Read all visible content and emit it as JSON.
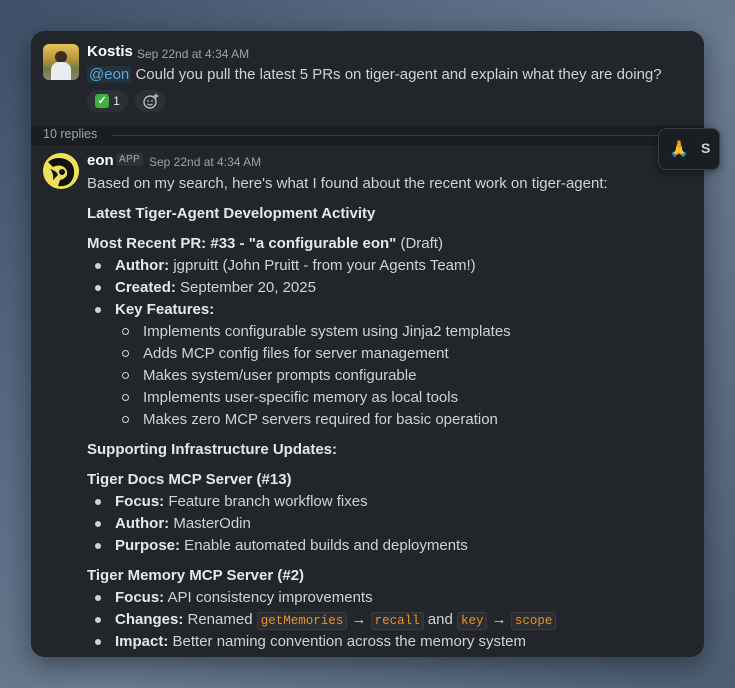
{
  "message1": {
    "author": "Kostis",
    "timestamp": "Sep 22nd at 4:34 AM",
    "mention": "@eon",
    "text": "Could you pull the latest 5 PRs on tiger-agent and explain what they are doing?",
    "reaction": {
      "emoji": "white-check-mark",
      "count": "1"
    }
  },
  "thread": {
    "replies_label": "10 replies"
  },
  "message2": {
    "author": "eon",
    "badge": "APP",
    "timestamp": "Sep 22nd at 4:34 AM",
    "intro": "Based on my search, here's what I found about the recent work on tiger-agent:",
    "heading1": "Latest Tiger-Agent Development Activity",
    "pr33": {
      "title_bold": "Most Recent PR: #33 - \"a configurable eon\"",
      "title_suffix": " (Draft)",
      "author_label": "Author:",
      "author_value": " jgpruitt (John Pruitt - from your Agents Team!)",
      "created_label": "Created:",
      "created_value": " September 20, 2025",
      "features_label": "Key Features:",
      "features": [
        "Implements configurable system using Jinja2 templates",
        "Adds MCP config files for server management",
        "Makes system/user prompts configurable",
        "Implements user-specific memory as local tools",
        "Makes zero MCP servers required for basic operation"
      ]
    },
    "heading2": "Supporting Infrastructure Updates:",
    "docs": {
      "title": "Tiger Docs MCP Server (#13)",
      "focus_label": "Focus:",
      "focus_value": " Feature branch workflow fixes",
      "author_label": "Author:",
      "author_value": " MasterOdin",
      "purpose_label": "Purpose:",
      "purpose_value": " Enable automated builds and deployments"
    },
    "memory": {
      "title": "Tiger Memory MCP Server (#2)",
      "focus_label": "Focus:",
      "focus_value": " API consistency improvements",
      "changes_label": "Changes:",
      "changes_pre": " Renamed ",
      "code1": "getMemories",
      "arrow1": " → ",
      "code2": "recall",
      "and": " and ",
      "code3": "key",
      "arrow2": " → ",
      "code4": "scope",
      "impact_label": "Impact:",
      "impact_value": " Better naming convention across the memory system"
    }
  },
  "floating": {
    "emoji": "🙏",
    "letter": "S"
  },
  "colors": {
    "mention": "#5fa7d8",
    "code": "#e8912d",
    "check": "#3fae43",
    "panel": "#222529"
  }
}
